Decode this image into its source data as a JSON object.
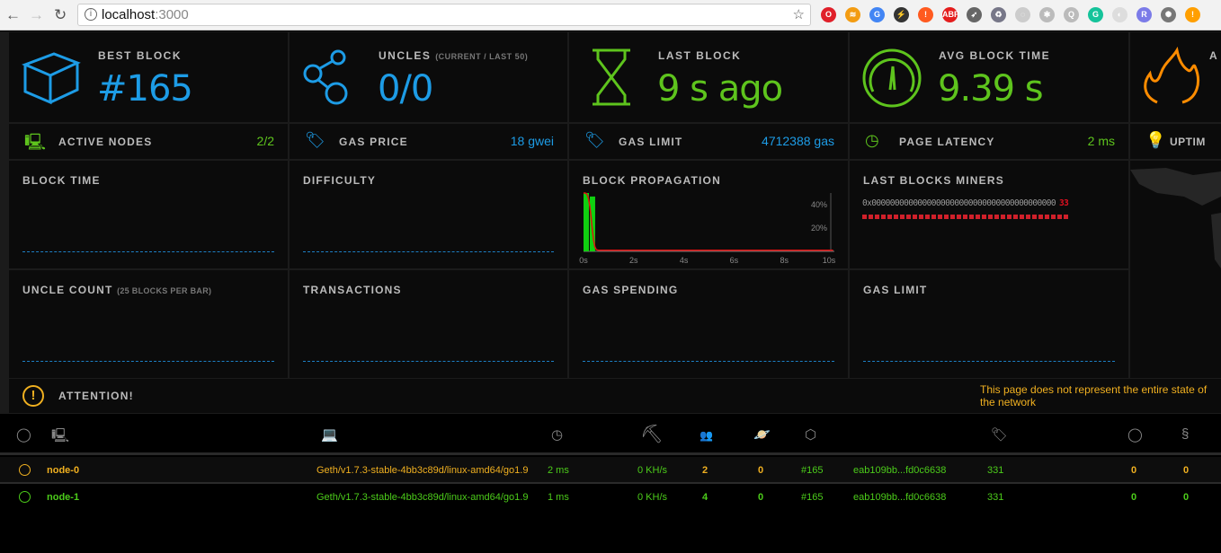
{
  "browser": {
    "url_host": "localhost",
    "url_port": ":3000",
    "back": "←",
    "forward": "→",
    "reload": "↻",
    "star": "☆",
    "extensions": [
      {
        "name": "opera-icon",
        "color": "#e0202a",
        "label": "O"
      },
      {
        "name": "rss-icon",
        "color": "#f39c12",
        "label": "≋"
      },
      {
        "name": "translate-icon",
        "color": "#4285f4",
        "label": "G"
      },
      {
        "name": "bolt-icon",
        "color": "#333",
        "label": "⚡"
      },
      {
        "name": "alert-icon",
        "color": "#ff5a1f",
        "label": "!"
      },
      {
        "name": "adblock-icon",
        "color": "#e41d1d",
        "label": "ABP"
      },
      {
        "name": "rocket-icon",
        "color": "#666",
        "label": "➶"
      },
      {
        "name": "recycle-icon",
        "color": "#778",
        "label": "♻"
      },
      {
        "name": "shield-icon",
        "color": "#ccc",
        "label": "◌"
      },
      {
        "name": "puzzle-icon",
        "color": "#bbb",
        "label": "✱"
      },
      {
        "name": "search-ext-icon",
        "color": "#bbb",
        "label": "Q"
      },
      {
        "name": "grammarly-icon",
        "color": "#15c39a",
        "label": "G"
      },
      {
        "name": "loop-icon",
        "color": "#ddd",
        "label": "◐"
      },
      {
        "name": "r-icon",
        "color": "#7b7be8",
        "label": "R"
      },
      {
        "name": "globe-icon",
        "color": "#777",
        "label": "✺"
      },
      {
        "name": "warning-icon",
        "color": "#ff9f00",
        "label": "!"
      }
    ]
  },
  "stats": [
    {
      "label": "BEST BLOCK",
      "sub": "",
      "value": "#165",
      "color": "#1d9ce6",
      "icon": "cube-icon"
    },
    {
      "label": "UNCLES",
      "sub": "(CURRENT / LAST 50)",
      "value": "0/0",
      "color": "#1d9ce6",
      "icon": "uncles-icon"
    },
    {
      "label": "LAST BLOCK",
      "sub": "",
      "value": "9 s ago",
      "color": "#5ec41d",
      "icon": "hourglass-icon"
    },
    {
      "label": "AVG BLOCK TIME",
      "sub": "",
      "value": "9.39 s",
      "color": "#5ec41d",
      "icon": "gauge-icon"
    },
    {
      "label": "A",
      "sub": "",
      "value": "",
      "color": "#ff8c00",
      "icon": "flame-icon"
    }
  ],
  "rows": [
    {
      "label": "ACTIVE NODES",
      "value": "2/2",
      "color": "#5ec41d",
      "icon": "laptop-icon"
    },
    {
      "label": "GAS PRICE",
      "value": "18 gwei",
      "color": "#1d9ce6",
      "icon": "tag-icon"
    },
    {
      "label": "GAS LIMIT",
      "value": "4712388 gas",
      "color": "#1d9ce6",
      "icon": "tag-icon"
    },
    {
      "label": "PAGE LATENCY",
      "value": "2 ms",
      "color": "#5ec41d",
      "icon": "timer-icon"
    },
    {
      "label": "UPTIM",
      "value": "",
      "color": "#5ec41d",
      "icon": "bulb-icon"
    }
  ],
  "charts": {
    "block_time": "BLOCK TIME",
    "difficulty": "DIFFICULTY",
    "block_propagation": "BLOCK PROPAGATION",
    "last_blocks_miners": "LAST BLOCKS MINERS",
    "uncle_count": "UNCLE COUNT",
    "uncle_count_sub": "(25 BLOCKS PER BAR)",
    "transactions": "TRANSACTIONS",
    "gas_spending": "GAS SPENDING",
    "gas_limit": "GAS LIMIT"
  },
  "chart_data": {
    "type": "bar",
    "title": "BLOCK PROPAGATION",
    "x": [
      "0s",
      "2s",
      "4s",
      "6s",
      "8s",
      "10s"
    ],
    "y_ticks": [
      "40%",
      "20%"
    ],
    "ylim": [
      0,
      50
    ],
    "bins": [
      {
        "x": 0,
        "value": 50
      },
      {
        "x": 0.25,
        "value": 47
      }
    ],
    "curve_color": "#e01010",
    "bar_color": "#10d010"
  },
  "miners": {
    "address": "0x0000000000000000000000000000000000000000",
    "count": "33",
    "blocks": 33,
    "color": "#d0202a"
  },
  "attention": {
    "label": "ATTENTION!",
    "message": "This page does not represent the entire state of the network"
  },
  "nodes": [
    {
      "name": "node-0",
      "client": "Geth/v1.7.3-stable-4bb3c89d/linux-amd64/go1.9",
      "latency": "2 ms",
      "hashrate": "0 KH/s",
      "peers": "2",
      "pending": "0",
      "block": "#165",
      "hash": "eab109bb...fd0c6638",
      "difficulty": "331",
      "propagation": "0",
      "uncles": "0",
      "color": "#f0b020"
    },
    {
      "name": "node-1",
      "client": "Geth/v1.7.3-stable-4bb3c89d/linux-amd64/go1.9",
      "latency": "1 ms",
      "hashrate": "0 KH/s",
      "peers": "4",
      "pending": "0",
      "block": "#165",
      "hash": "eab109bb...fd0c6638",
      "difficulty": "331",
      "propagation": "0",
      "uncles": "0",
      "color": "#4ccc1a"
    }
  ]
}
